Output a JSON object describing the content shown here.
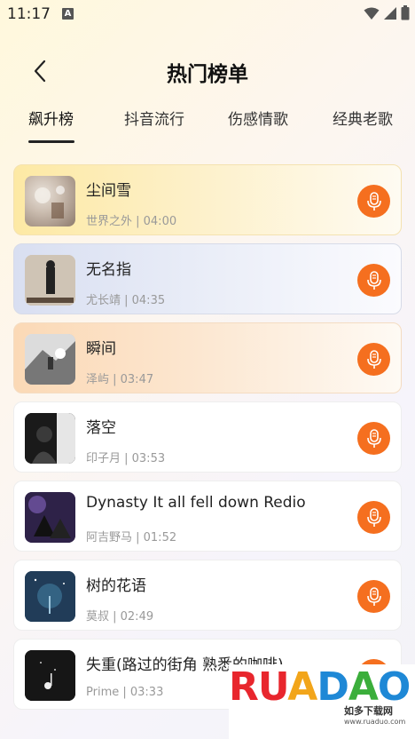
{
  "status": {
    "time": "11:17",
    "indicator": "A"
  },
  "header": {
    "title": "热门榜单",
    "back_icon": "chevron-left-icon"
  },
  "tabs": [
    {
      "label": "飙升榜",
      "active": true
    },
    {
      "label": "抖音流行",
      "active": false
    },
    {
      "label": "伤感情歌",
      "active": false
    },
    {
      "label": "经典老歌",
      "active": false
    }
  ],
  "songs": [
    {
      "title": "尘间雪",
      "meta": "世界之外 | 04:00"
    },
    {
      "title": "无名指",
      "meta": "尤长靖 | 04:35"
    },
    {
      "title": "瞬间",
      "meta": "泽屿 | 03:47"
    },
    {
      "title": "落空",
      "meta": "印子月 | 03:53"
    },
    {
      "title": "Dynasty It all fell down Redio",
      "meta": "阿吉野马 | 01:52"
    },
    {
      "title": "树的花语",
      "meta": "莫叔 | 02:49"
    },
    {
      "title": "失重(路过的街角 熟悉的咖啡)",
      "meta": "Prime | 03:33"
    }
  ],
  "watermark": {
    "logo": "RUANDAO",
    "sub": "如多下载网",
    "url": "www.ruaduo.com"
  },
  "colors": {
    "accent": "#f56f1f"
  }
}
